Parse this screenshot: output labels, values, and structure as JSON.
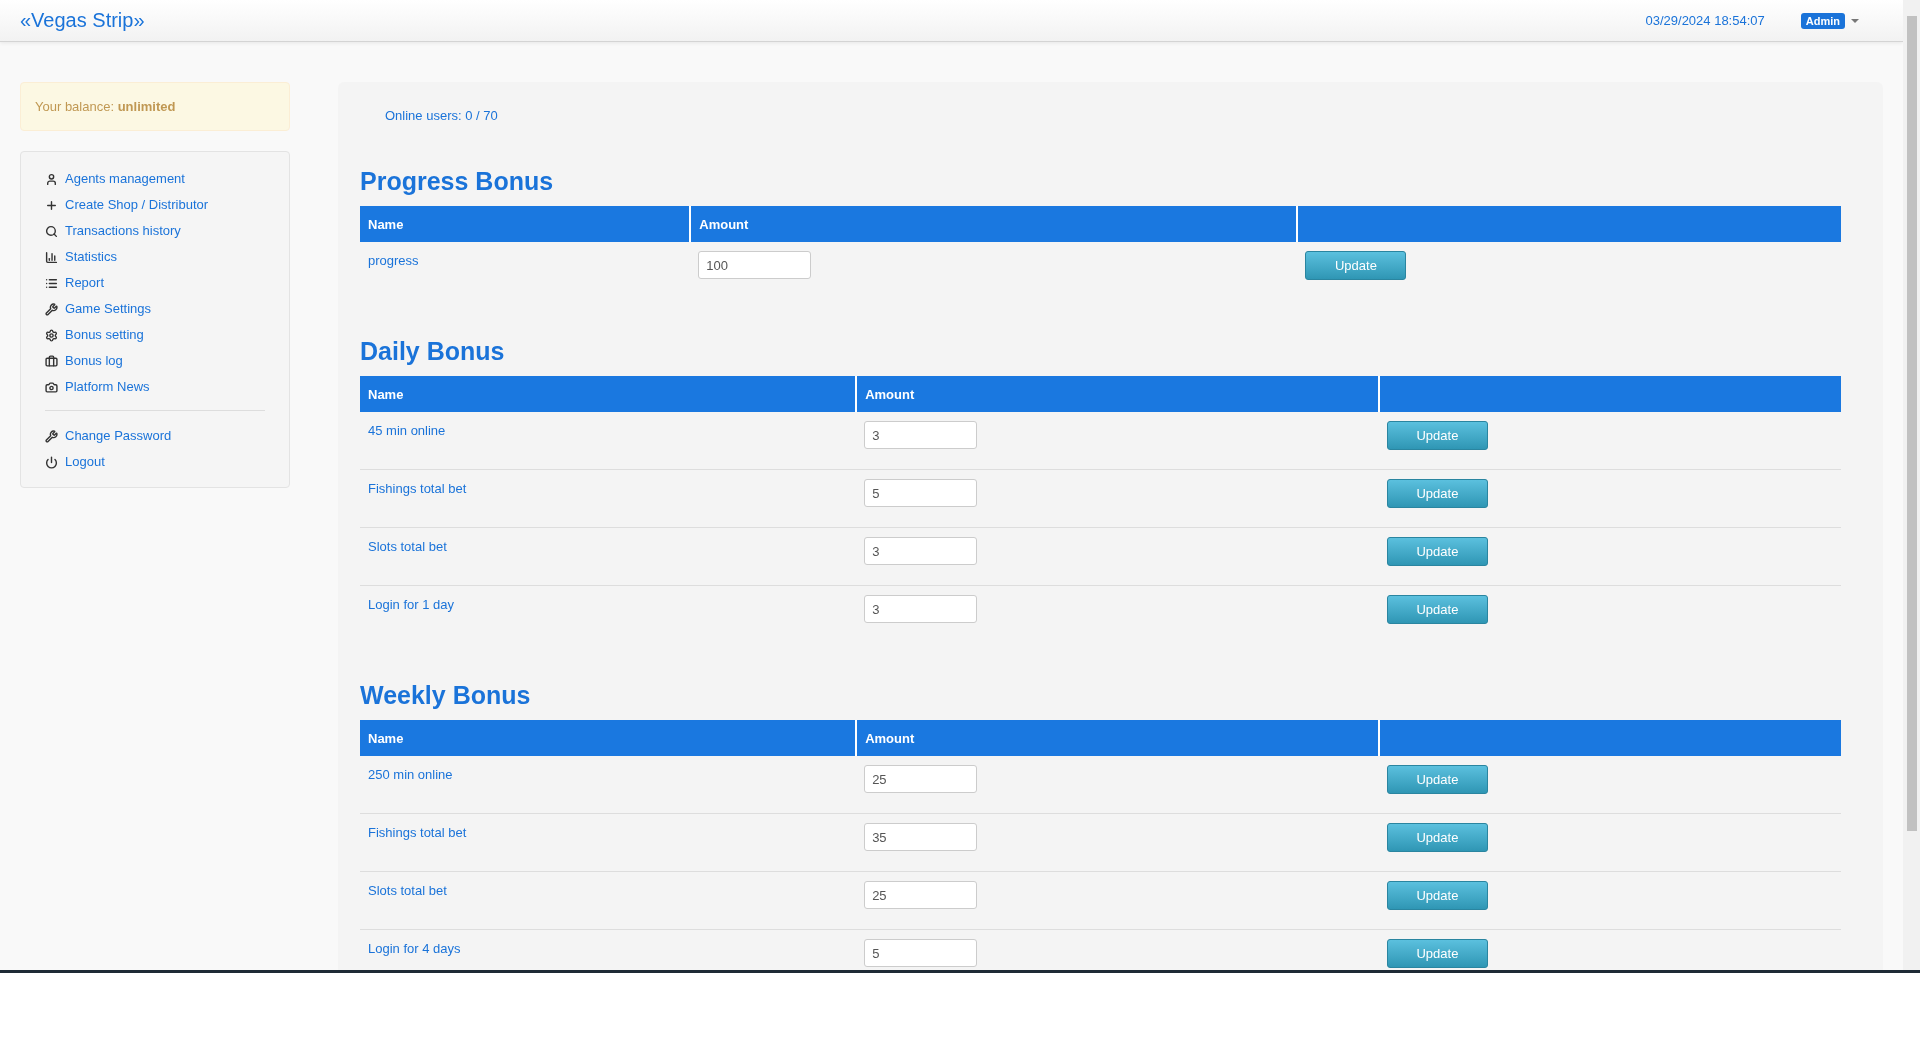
{
  "header": {
    "brand": "«Vegas Strip»",
    "datetime": "03/29/2024 18:54:07",
    "user_badge": "Admin"
  },
  "sidebar": {
    "balance_label": "Your balance:",
    "balance_value": "unlimited",
    "menu": [
      {
        "label": "Agents management"
      },
      {
        "label": "Create Shop / Distributor"
      },
      {
        "label": "Transactions history"
      },
      {
        "label": "Statistics"
      },
      {
        "label": "Report"
      },
      {
        "label": "Game Settings"
      },
      {
        "label": "Bonus setting"
      },
      {
        "label": "Bonus log"
      },
      {
        "label": "Platform News"
      }
    ],
    "account_menu": [
      {
        "label": "Change Password"
      },
      {
        "label": "Logout"
      }
    ]
  },
  "online_users": "Online users: 0 / 70",
  "sections": [
    {
      "title": "Progress Bonus",
      "columns": [
        "Name",
        "Amount"
      ],
      "rows": [
        {
          "name": "progress",
          "amount": "100",
          "button": "Update"
        }
      ]
    },
    {
      "title": "Daily Bonus",
      "columns": [
        "Name",
        "Amount"
      ],
      "rows": [
        {
          "name": "45 min online",
          "amount": "3",
          "button": "Update"
        },
        {
          "name": "Fishings total bet",
          "amount": "5",
          "button": "Update"
        },
        {
          "name": "Slots total bet",
          "amount": "3",
          "button": "Update"
        },
        {
          "name": "Login for 1 day",
          "amount": "3",
          "button": "Update"
        }
      ]
    },
    {
      "title": "Weekly Bonus",
      "columns": [
        "Name",
        "Amount"
      ],
      "rows": [
        {
          "name": "250 min online",
          "amount": "25",
          "button": "Update"
        },
        {
          "name": "Fishings total bet",
          "amount": "35",
          "button": "Update"
        },
        {
          "name": "Slots total bet",
          "amount": "25",
          "button": "Update"
        },
        {
          "name": "Login for 4 days",
          "amount": "5",
          "button": "Update"
        }
      ]
    }
  ]
}
